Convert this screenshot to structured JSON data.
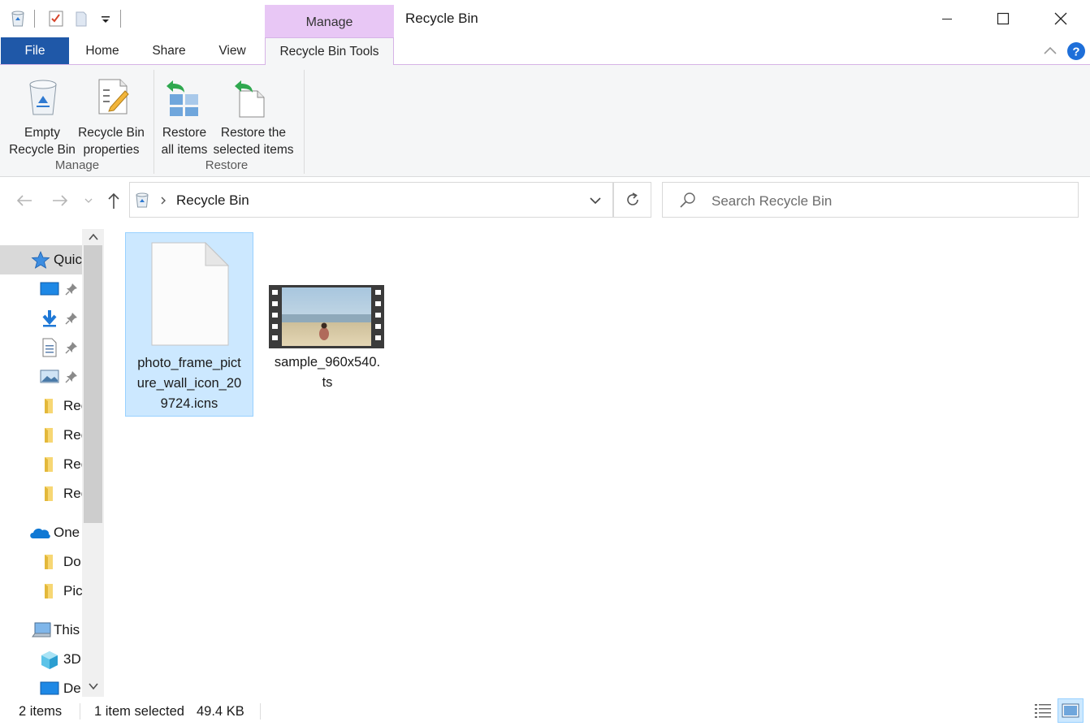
{
  "window": {
    "context_tab": "Manage",
    "title": "Recycle Bin"
  },
  "tabs": {
    "file": "File",
    "home": "Home",
    "share": "Share",
    "view": "View",
    "recycle_bin_tools": "Recycle Bin Tools"
  },
  "ribbon": {
    "empty_line1": "Empty",
    "empty_line2": "Recycle Bin",
    "props_line1": "Recycle Bin",
    "props_line2": "properties",
    "group_manage": "Manage",
    "restore_all_line1": "Restore",
    "restore_all_line2": "all items",
    "restore_sel_line1": "Restore the",
    "restore_sel_line2": "selected items",
    "group_restore": "Restore"
  },
  "address": {
    "path": "Recycle Bin",
    "search_placeholder": "Search Recycle Bin"
  },
  "nav": {
    "quick_access": "Quic",
    "folder1": "Rec",
    "folder2": "Rec",
    "folder3": "Rec",
    "folder4": "Rec",
    "onedrive": "One",
    "od_documents": "Do",
    "od_pictures": "Pic",
    "this_pc": "This",
    "objects3d": "3D",
    "desktop": "De"
  },
  "files": [
    {
      "name_line1": "photo_frame_pict",
      "name_line2": "ure_wall_icon_20",
      "name_line3": "9724.icns",
      "selected": true,
      "icon": "blank-file-icon"
    },
    {
      "name_line1": "sample_960x540.",
      "name_line2": "ts",
      "selected": false,
      "icon": "video-thumbnail-icon"
    }
  ],
  "status": {
    "count": "2 items",
    "selection": "1 item selected",
    "size": "49.4 KB"
  },
  "colors": {
    "file_tab": "#1f58a8",
    "context_tab": "#e8c7f5",
    "selection": "#cce8ff",
    "help": "#1e6fd9"
  }
}
